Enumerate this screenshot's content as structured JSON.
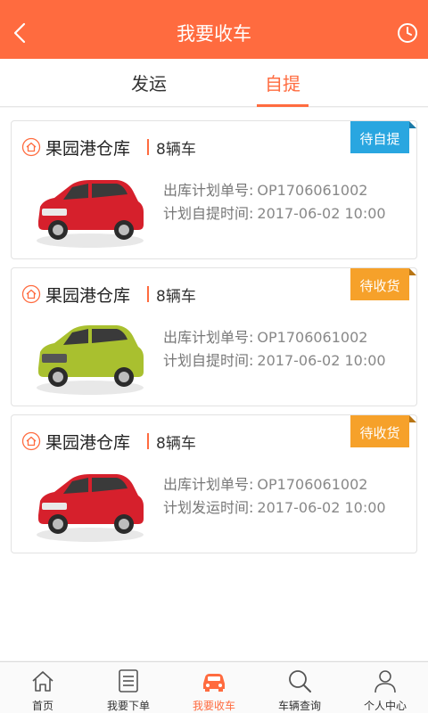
{
  "header": {
    "title": "我要收车"
  },
  "tabs": [
    {
      "label": "发运"
    },
    {
      "label": "自提"
    }
  ],
  "orders": [
    {
      "warehouse": "果园港仓库",
      "count": "8辆车",
      "status": "待自提",
      "status_color": "#29a6e0",
      "car_color": "#d6202c",
      "plan_no_label": "出库计划单号:",
      "plan_no": "OP1706061002",
      "time_label": "计划自提时间:",
      "time": "2017-06-02 10:00"
    },
    {
      "warehouse": "果园港仓库",
      "count": "8辆车",
      "status": "待收货",
      "status_color": "#f6a12a",
      "car_color": "#a9c02f",
      "plan_no_label": "出库计划单号:",
      "plan_no": "OP1706061002",
      "time_label": "计划自提时间:",
      "time": "2017-06-02 10:00"
    },
    {
      "warehouse": "果园港仓库",
      "count": "8辆车",
      "status": "待收货",
      "status_color": "#f6a12a",
      "car_color": "#d6202c",
      "plan_no_label": "出库计划单号:",
      "plan_no": "OP1706061002",
      "time_label": "计划发运时间:",
      "time": "2017-06-02 10:00"
    }
  ],
  "nav": [
    {
      "label": "首页",
      "icon": "home-icon"
    },
    {
      "label": "我要下单",
      "icon": "order-icon"
    },
    {
      "label": "我要收车",
      "icon": "car-icon"
    },
    {
      "label": "车辆查询",
      "icon": "search-icon"
    },
    {
      "label": "个人中心",
      "icon": "user-icon"
    }
  ],
  "colors": {
    "accent": "#ff6b3f",
    "blue_badge": "#29a6e0",
    "orange_badge": "#f6a12a"
  }
}
